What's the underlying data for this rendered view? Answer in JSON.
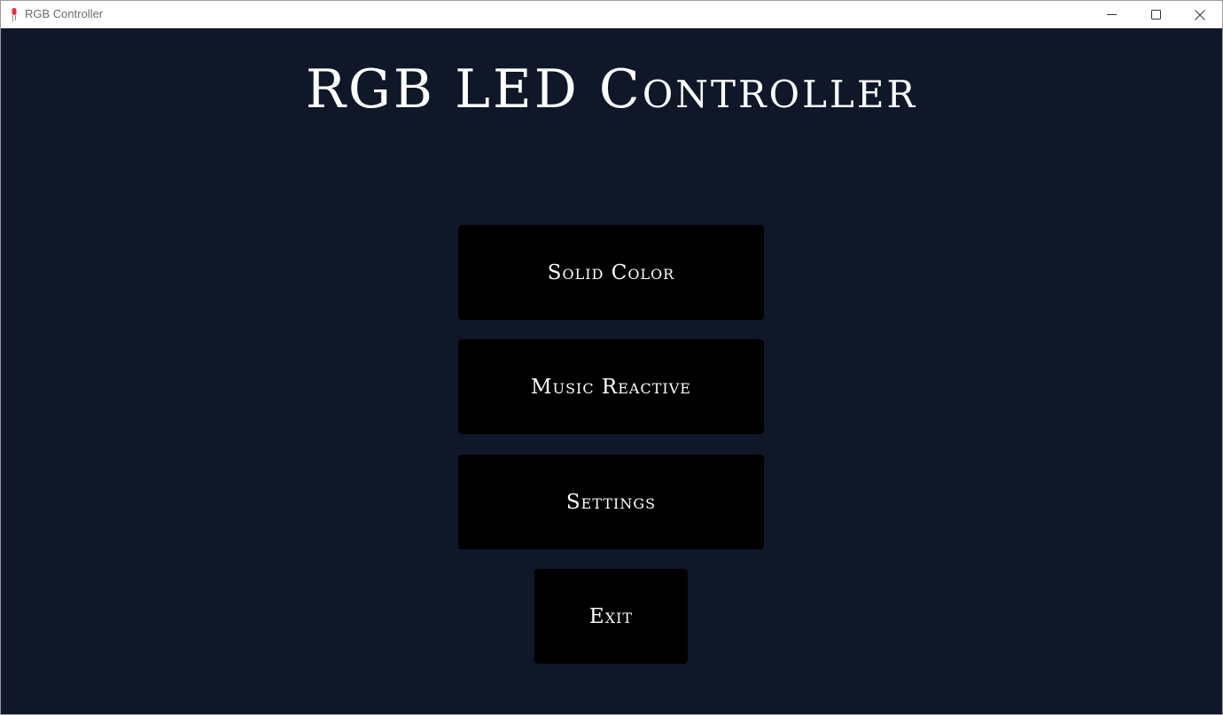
{
  "window": {
    "title": "RGB Controller",
    "app_icon": "led-icon",
    "controls": {
      "minimize_icon": "minimize-icon",
      "maximize_icon": "maximize-icon",
      "close_icon": "close-icon"
    }
  },
  "main": {
    "title": "RGB LED Controller",
    "buttons": [
      {
        "label": "Solid Color"
      },
      {
        "label": "Music Reactive"
      },
      {
        "label": "Settings"
      },
      {
        "label": "Exit"
      }
    ]
  },
  "colors": {
    "background": "#0f1729",
    "button_background": "#000000",
    "text": "#ffffff",
    "icon_accent": "#e0303a"
  }
}
